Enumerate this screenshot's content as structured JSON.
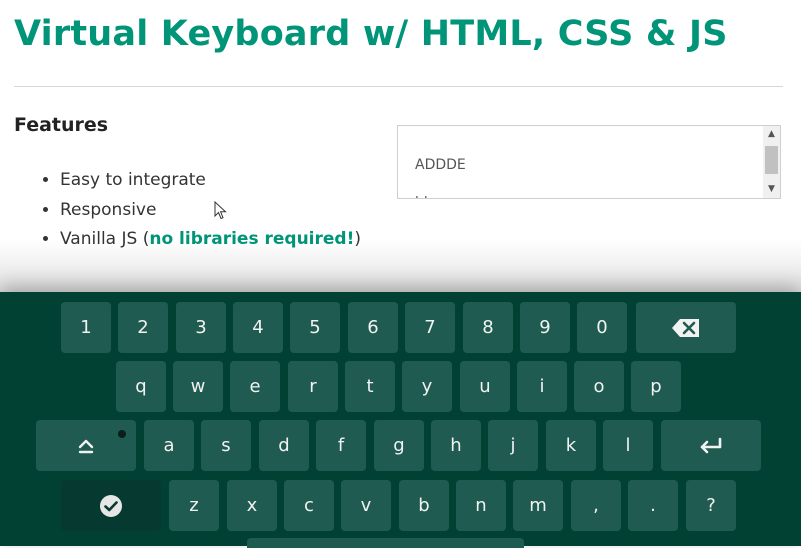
{
  "page": {
    "title": "Virtual Keyboard w/ HTML, CSS & JS",
    "features_heading": "Features",
    "features": [
      "Easy to integrate",
      "Responsive"
    ],
    "feature3_prefix": "Vanilla JS (",
    "feature3_highlight": "no libraries required!",
    "feature3_suffix": ")"
  },
  "textarea": {
    "lines": [
      "ADDDE",
      "hh"
    ]
  },
  "keyboard": {
    "row1": [
      "1",
      "2",
      "3",
      "4",
      "5",
      "6",
      "7",
      "8",
      "9",
      "0"
    ],
    "row2": [
      "q",
      "w",
      "e",
      "r",
      "t",
      "y",
      "u",
      "i",
      "o",
      "p"
    ],
    "row3": [
      "a",
      "s",
      "d",
      "f",
      "g",
      "h",
      "j",
      "k",
      "l"
    ],
    "row4": [
      "z",
      "x",
      "c",
      "v",
      "b",
      "n",
      "m",
      ",",
      ".",
      "?"
    ],
    "icons": {
      "backspace": "backspace-icon",
      "caps": "caps-lock-icon",
      "enter": "enter-icon",
      "done": "check-icon"
    },
    "accent_color": "#009578",
    "background_color": "#004134"
  }
}
